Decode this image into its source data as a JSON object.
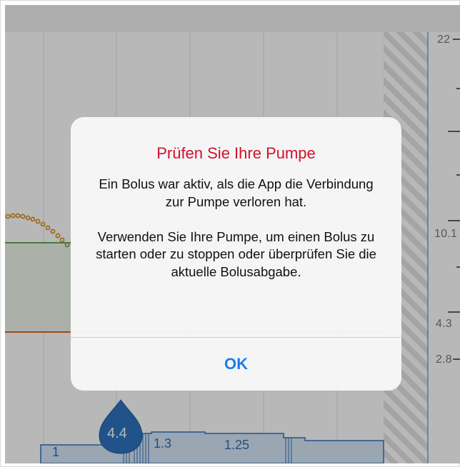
{
  "graph": {
    "y_axis_labels": [
      "22",
      "10.1",
      "4.3",
      "2.8"
    ],
    "bolus_values": [
      "1",
      "1.3",
      "1.25"
    ],
    "bolus_drop_value": "4.4"
  },
  "alert": {
    "title": "Prüfen Sie Ihre Pumpe",
    "message_line_1": "Ein Bolus war aktiv, als die App die Verbindung zur Pumpe verloren hat.",
    "message_line_2": "Verwenden Sie Ihre Pumpe, um einen Bolus zu starten oder zu stoppen oder überprüfen Sie die aktuelle Bolusabgabe.",
    "ok_label": "OK"
  },
  "colors": {
    "alert_title": "#d1122a",
    "ok_button": "#1b7cf0",
    "target_range_line": "#d8641e",
    "glucose_dots": "#d98a1a",
    "bolus_blue": "#2f74c0"
  }
}
